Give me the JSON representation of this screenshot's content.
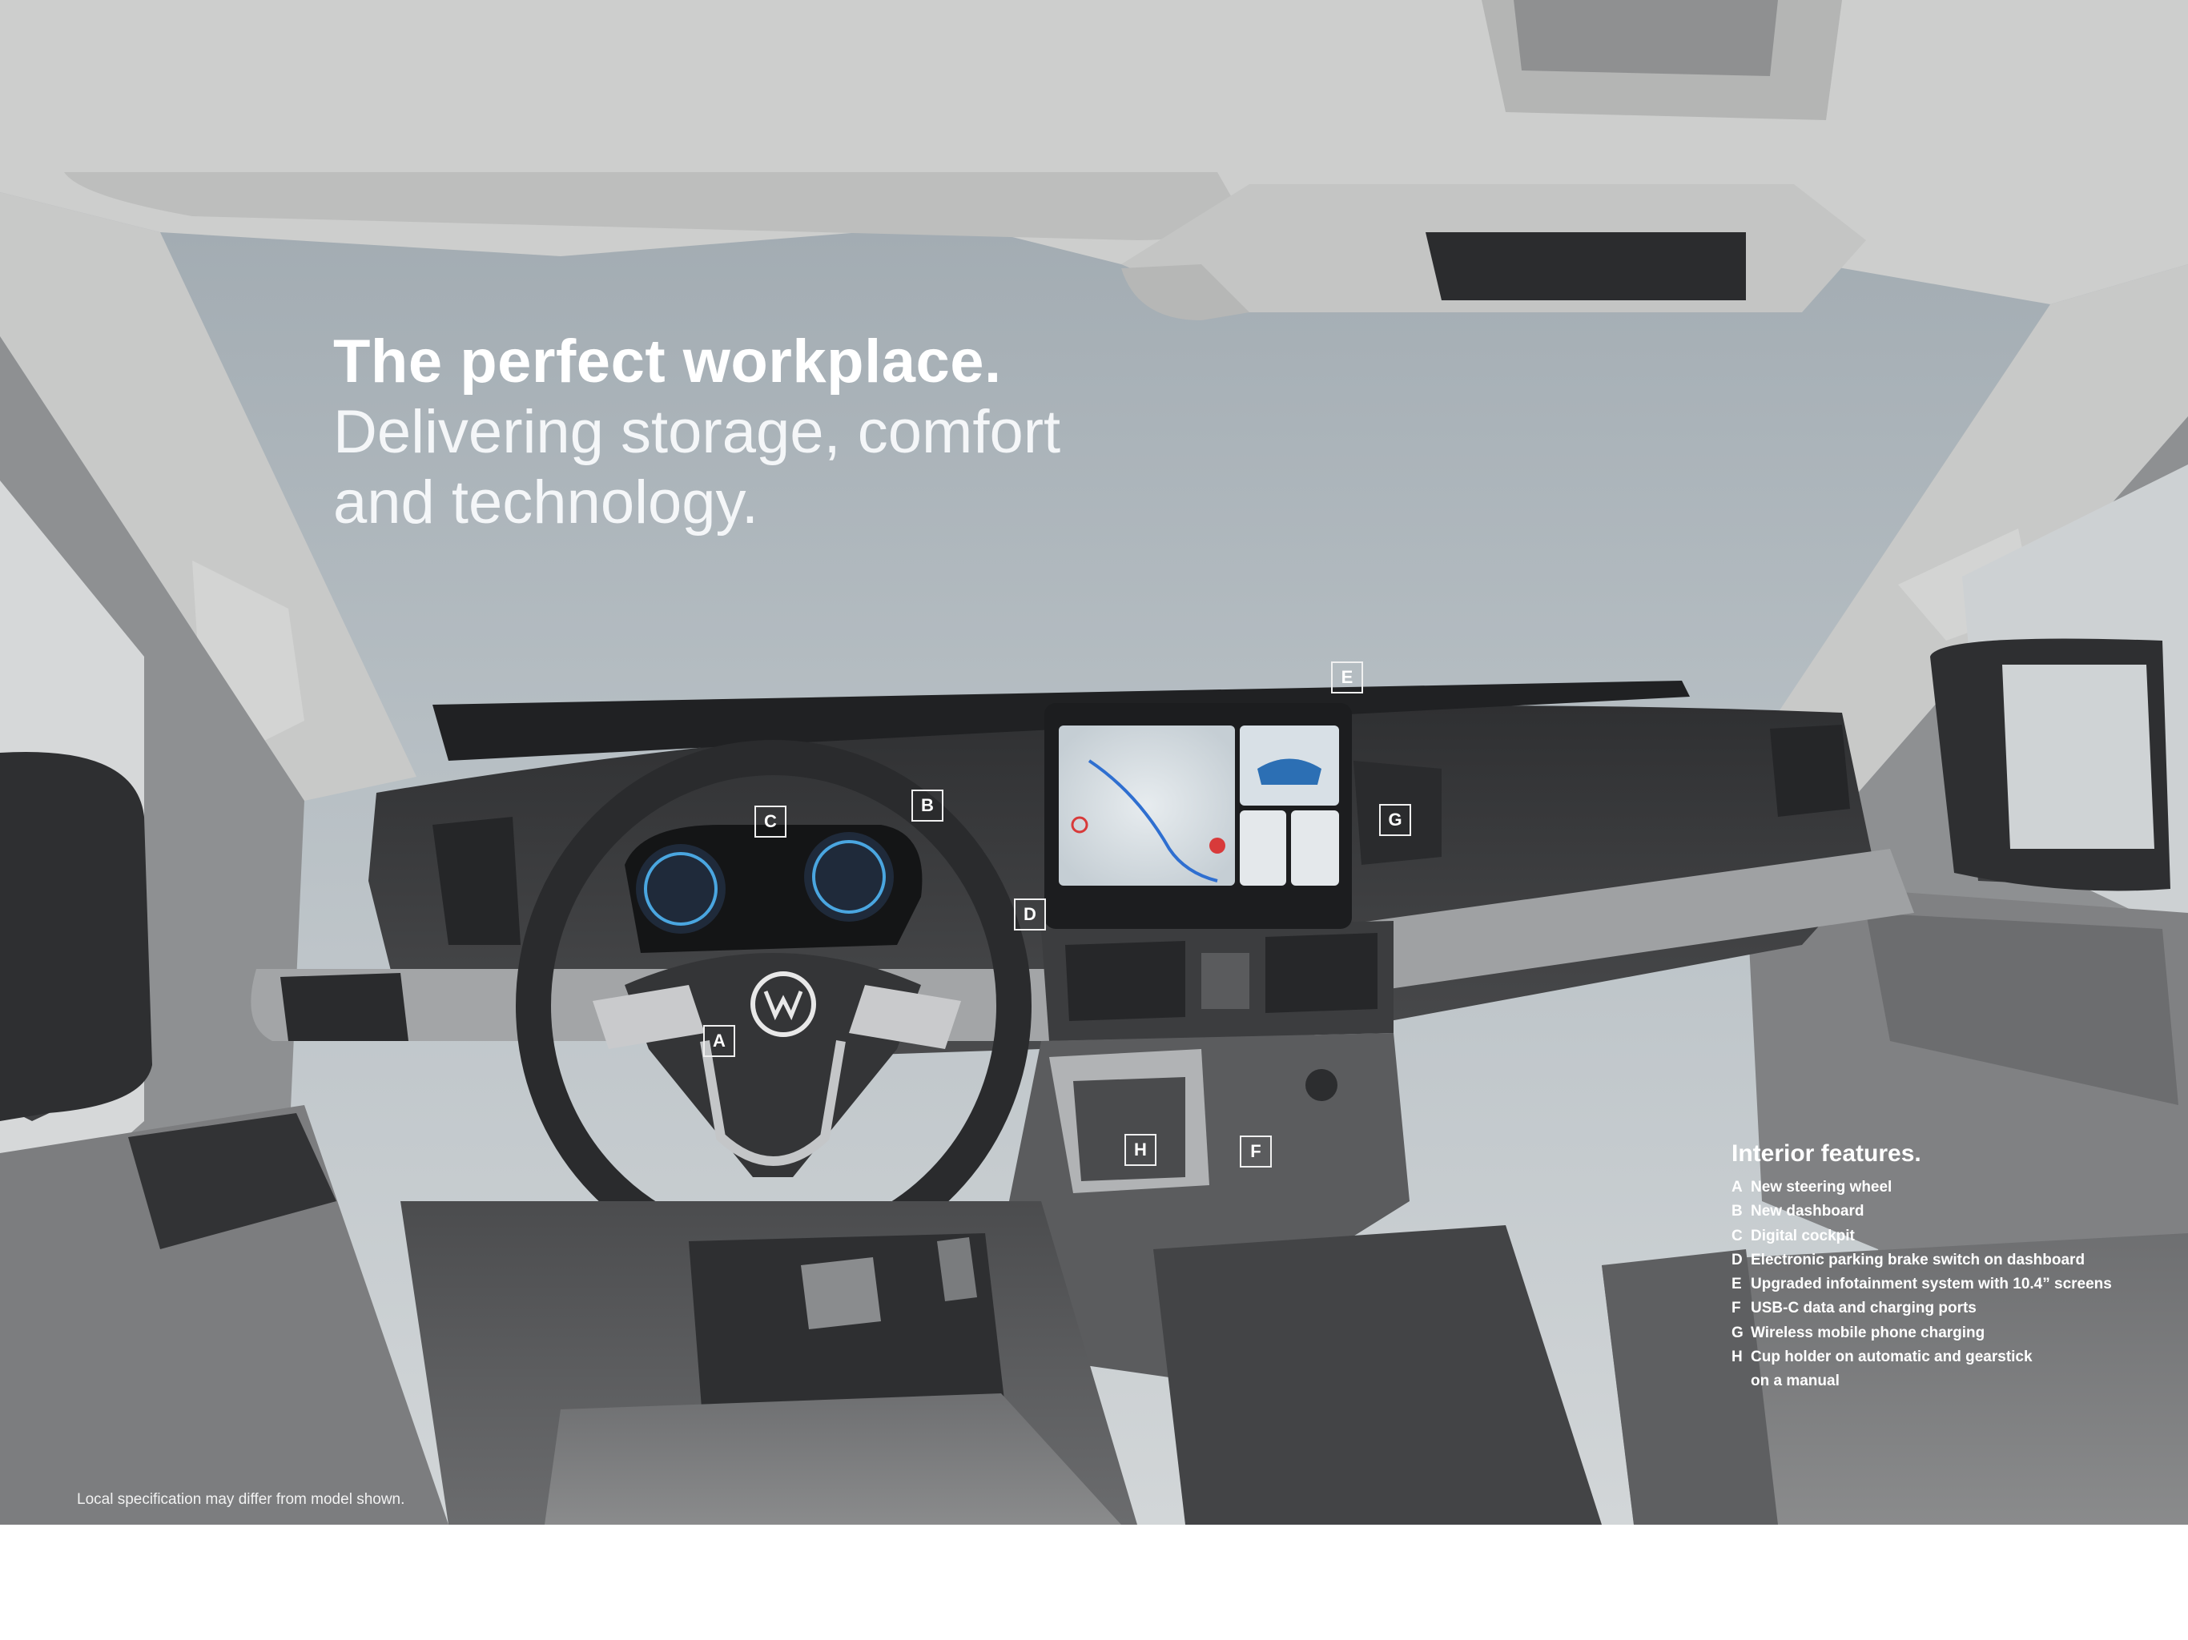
{
  "headline": {
    "bold": "The perfect workplace.",
    "light_line1": "Delivering storage, comfort",
    "light_line2": "and technology."
  },
  "markers": [
    "A",
    "B",
    "C",
    "D",
    "E",
    "F",
    "G",
    "H"
  ],
  "features": {
    "title": "Interior features.",
    "items": [
      {
        "letter": "A",
        "text": "New steering wheel"
      },
      {
        "letter": "B",
        "text": "New dashboard"
      },
      {
        "letter": "C",
        "text": "Digital cockpit"
      },
      {
        "letter": "D",
        "text": "Electronic parking brake switch on dashboard"
      },
      {
        "letter": "E",
        "text": "Upgraded infotainment system with 10.4” screens"
      },
      {
        "letter": "F",
        "text": "USB-C data and charging ports"
      },
      {
        "letter": "G",
        "text": "Wireless mobile phone charging"
      },
      {
        "letter": "H",
        "text": "Cup holder on automatic and gearstick",
        "continuation": "on a manual"
      }
    ]
  },
  "disclaimer": "Local specification may differ from model shown.",
  "colors": {
    "windshield": "#b9c1c6",
    "dashboard": "#3a3b3d",
    "headliner": "#cfd0cf",
    "trim": "#a9abad",
    "text": "#ffffff"
  }
}
